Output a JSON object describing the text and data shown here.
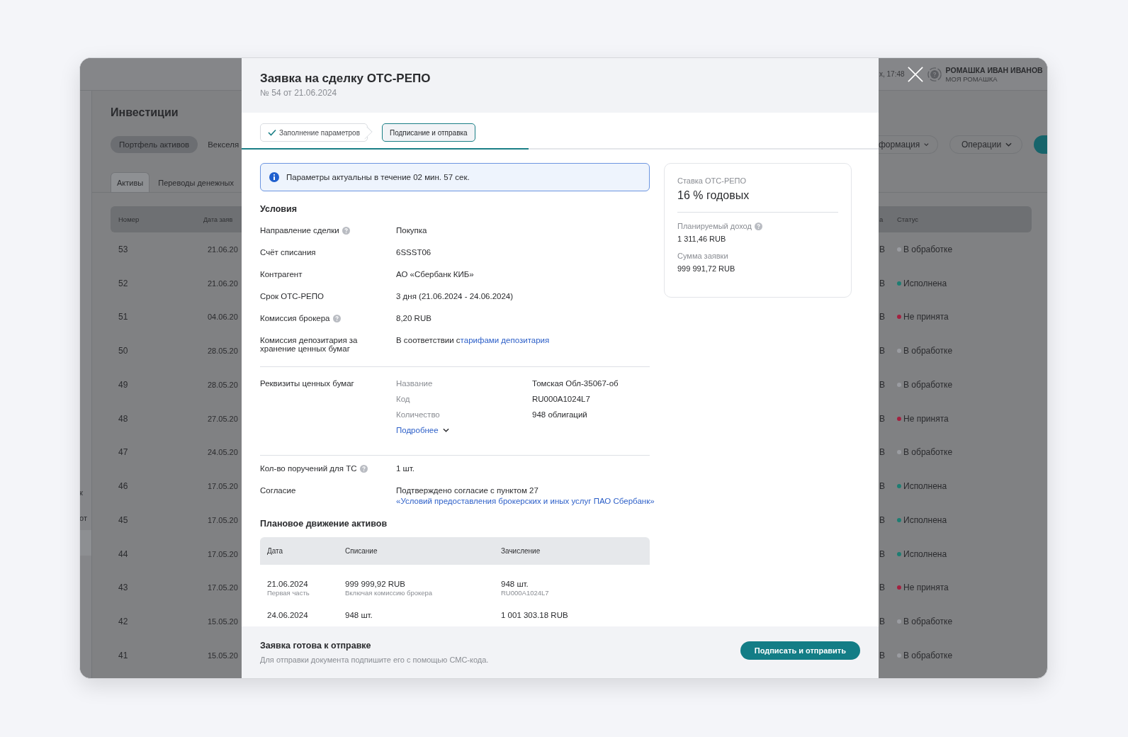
{
  "app": {
    "sidebar_fragments": [
      "к",
      "от"
    ],
    "header": {
      "time_fragment": "х, 17:48",
      "user_name": "РОМАШКА ИВАН ИВАНОВ",
      "company": "МОЯ РОМАШКА"
    },
    "title": "Инвестиции",
    "tabs": [
      {
        "label": "Портфель активов",
        "selected": true
      },
      {
        "label": "Векселя",
        "selected": false
      }
    ],
    "menus": [
      {
        "label": "формация"
      },
      {
        "label": "Операции"
      }
    ],
    "subtabs": [
      {
        "label": "Активы",
        "selected": true
      },
      {
        "label": "Переводы денежных",
        "selected": false
      }
    ],
    "table": {
      "columns_left": [
        "Номер",
        "Дата заяв"
      ],
      "columns_right": [
        "а",
        "Статус"
      ],
      "rows": [
        {
          "number": "53",
          "date": "21.06.20",
          "column_3": "В",
          "status": "В обработке",
          "color": "#9a9ca1"
        },
        {
          "number": "52",
          "date": "21.06.20",
          "column_3": "В",
          "status": "Исполнена",
          "color": "#1d7d72"
        },
        {
          "number": "51",
          "date": "04.06.20",
          "column_3": "В",
          "status": "Не принята",
          "color": "#a3203f"
        },
        {
          "number": "50",
          "date": "28.05.20",
          "column_3": "В",
          "status": "В обработке",
          "color": "#9a9ca1"
        },
        {
          "number": "49",
          "date": "28.05.20",
          "column_3": "В",
          "status": "В обработке",
          "color": "#9a9ca1"
        },
        {
          "number": "48",
          "date": "27.05.20",
          "column_3": "В",
          "status": "Не принята",
          "color": "#a3203f"
        },
        {
          "number": "47",
          "date": "24.05.20",
          "column_3": "В",
          "status": "В обработке",
          "color": "#9a9ca1"
        },
        {
          "number": "46",
          "date": "17.05.20",
          "column_3": "В",
          "status": "Исполнена",
          "color": "#1d7d72"
        },
        {
          "number": "45",
          "date": "17.05.20",
          "column_3": "В",
          "status": "Исполнена",
          "color": "#1d7d72"
        },
        {
          "number": "44",
          "date": "17.05.20",
          "column_3": "В",
          "status": "Исполнена",
          "color": "#1d7d72"
        },
        {
          "number": "43",
          "date": "17.05.20",
          "column_3": "В",
          "status": "Не принята",
          "color": "#a3203f"
        },
        {
          "number": "42",
          "date": "15.05.20",
          "column_3": "В",
          "status": "В обработке",
          "color": "#9a9ca1"
        },
        {
          "number": "41",
          "date": "15.05.20",
          "column_3": "В",
          "status": "В обработке",
          "color": "#9a9ca1"
        }
      ]
    }
  },
  "modal": {
    "title": "Заявка на сделку ОТС-РЕПО",
    "subtitle": "№ 54 от 21.06.2024",
    "steps": [
      {
        "label": "Заполнение параметров",
        "done": true,
        "selected": false
      },
      {
        "label": "Подписание и отправка",
        "done": false,
        "selected": true
      }
    ],
    "progress": {
      "level": 0.45
    },
    "notice": "Параметры актуальны в течение 02 мин. 57 сек.",
    "conditions": {
      "heading": "Условия",
      "rows": [
        {
          "label": "Направление сделки",
          "help": true,
          "value": "Покупка"
        },
        {
          "label": "Счёт списания",
          "help": false,
          "value": "6SSST06"
        },
        {
          "label": "Контрагент",
          "help": false,
          "value": "АО «Сбербанк КИБ»"
        },
        {
          "label": "Срок ОТС-РЕПО",
          "help": false,
          "value": "3 дня (21.06.2024 - 24.06.2024)"
        },
        {
          "label": "Комиссия брокера",
          "help": true,
          "value": "8,20 RUB"
        },
        {
          "label": "Комиссия депозитария за хранение ценных бумаг",
          "help": false,
          "value": "В соответствии с",
          "link": "тарифами депозитария"
        }
      ]
    },
    "securities": {
      "label": "Реквизиты ценных бумаг",
      "fields": [
        {
          "name": "Название",
          "value": "Томская Обл-35067-об"
        },
        {
          "name": "Код",
          "value": "RU000A1024L7"
        },
        {
          "name": "Количество",
          "value": "948 облигаций"
        }
      ],
      "more_link": "Подробнее"
    },
    "orders": {
      "label": "Кол-во поручений для ТС",
      "help": true,
      "value": "1 шт."
    },
    "consent": {
      "label": "Согласие",
      "text": "Подтверждено согласие с пунктом 27",
      "link": "«Условий предоставления брокерских и иных услуг ПАО Сбербанк»"
    },
    "movement": {
      "heading": "Плановое движение активов",
      "columns": [
        "Дата",
        "Списание",
        "Зачисление"
      ],
      "rows": [
        {
          "cells": [
            {
              "main": "21.06.2024",
              "note": "Первая часть"
            },
            {
              "main": "999 999,92 RUB",
              "note": "Включая комиссию брокера"
            },
            {
              "main": "948 шт.",
              "note": "RU000A1024L7"
            }
          ]
        },
        {
          "cells": [
            {
              "main": "24.06.2024"
            },
            {
              "main": "948 шт."
            },
            {
              "main": "1 001 303.18 RUB"
            }
          ]
        }
      ]
    },
    "summary": {
      "rate_label": "Ставка ОТС-РЕПО",
      "rate": "16 % годовых",
      "items": [
        {
          "label": "Планируемый доход",
          "help": true,
          "value": "1 311,46 RUB"
        },
        {
          "label": "Сумма заявки",
          "help": false,
          "value": "999 991,72 RUB"
        }
      ]
    },
    "footer": {
      "title": "Заявка готова к отправке",
      "hint": "Для отправки документа подпишите его с помощью СМС-кода.",
      "button": "Подписать и отправить"
    }
  }
}
